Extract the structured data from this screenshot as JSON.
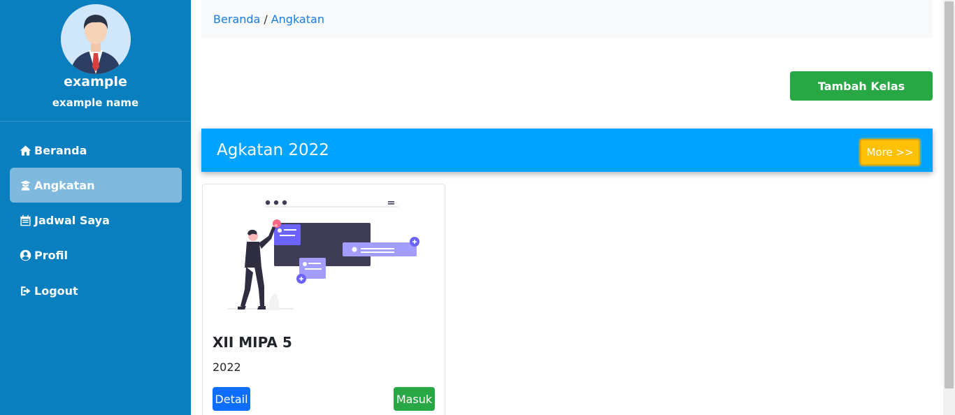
{
  "sidebar": {
    "profile": {
      "username": "example",
      "name": "example name",
      "avatar_icon": "user-avatar-icon"
    },
    "items": [
      {
        "label": "Beranda",
        "icon": "home-icon",
        "active": false
      },
      {
        "label": "Angkatan",
        "icon": "graduate-icon",
        "active": true
      },
      {
        "label": "Jadwal Saya",
        "icon": "calendar-icon",
        "active": false
      },
      {
        "label": "Profil",
        "icon": "user-circle-icon",
        "active": false
      },
      {
        "label": "Logout",
        "icon": "logout-icon",
        "active": false
      }
    ],
    "bg_color": "#0a7fc0"
  },
  "breadcrumb": {
    "home": "Beranda",
    "separator": "/",
    "current": "Angkatan"
  },
  "toolbar": {
    "add_class_label": "Tambah Kelas"
  },
  "group": {
    "title": "Agkatan 2022",
    "more_label": "More >>",
    "bar_color": "#00a3ff"
  },
  "cards": [
    {
      "title": "XII MIPA 5",
      "year": "2022",
      "detail_label": "Detail",
      "enter_label": "Masuk"
    }
  ]
}
